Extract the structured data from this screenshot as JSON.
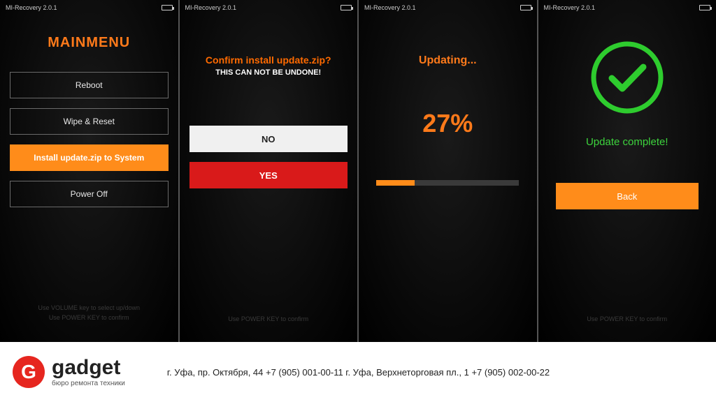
{
  "header": {
    "title": "MI-Recovery 2.0.1"
  },
  "screen1": {
    "title": "MAINMENU",
    "items": [
      "Reboot",
      "Wipe & Reset",
      "Install update.zip to System",
      "Power Off"
    ],
    "selected_index": 2,
    "hint1": "Use VOLUME key to select up/down",
    "hint2": "Use POWER KEY to confirm"
  },
  "screen2": {
    "title": "Confirm install update.zip?",
    "subtitle": "THIS CAN NOT BE UNDONE!",
    "no": "NO",
    "yes": "YES",
    "hint": "Use POWER KEY to confirm"
  },
  "screen3": {
    "title": "Updating...",
    "percent": "27%",
    "progress": 27
  },
  "screen4": {
    "title": "Update complete!",
    "back": "Back",
    "hint": "Use POWER KEY to confirm"
  },
  "footer": {
    "brand": "gadget",
    "tagline": "бюро ремонта техники",
    "contacts": "г. Уфа, пр. Октября, 44   +7 (905) 001-00-11 г. Уфа, Верхнеторговая пл., 1   +7 (905) 002-00-22"
  }
}
